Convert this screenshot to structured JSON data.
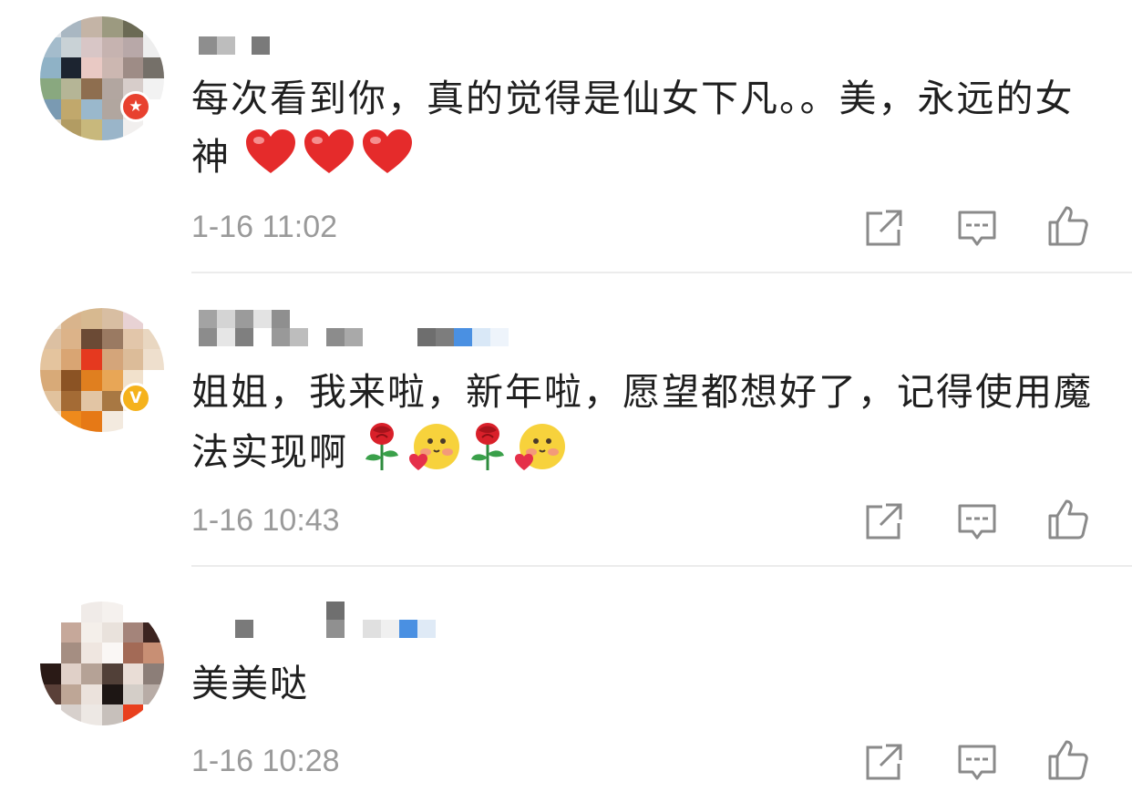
{
  "comments": [
    {
      "text": "每次看到你，真的觉得是仙女下凡。。美，永远的女神",
      "emojis": [
        "heart",
        "heart",
        "heart"
      ],
      "time": "1-16 11:02",
      "badge": "red-star"
    },
    {
      "text": "姐姐，我来啦，新年啦，愿望都想好了，记得使用魔法实现啊",
      "emojis": [
        "rose",
        "blush-heart-face",
        "rose",
        "blush-heart-face"
      ],
      "time": "1-16 10:43",
      "badge": "gold-v",
      "badge_label": "V"
    },
    {
      "text": "美美哒",
      "emojis": [],
      "time": "1-16 10:28",
      "badge": "none"
    }
  ],
  "actions": [
    "share-icon",
    "reply-icon",
    "like-icon"
  ],
  "colors": {
    "timestamp": "#9a9a9a",
    "icon": "#8a8a8a",
    "badge_red": "#e8412f",
    "badge_gold": "#f5b21c",
    "heart": "#e52b2b"
  }
}
